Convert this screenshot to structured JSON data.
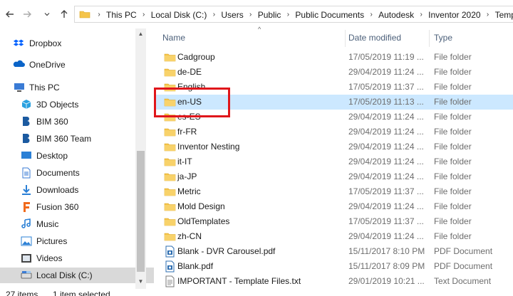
{
  "breadcrumb": [
    "This PC",
    "Local Disk (C:)",
    "Users",
    "Public",
    "Public Documents",
    "Autodesk",
    "Inventor 2020",
    "Templates"
  ],
  "columns": {
    "name": "Name",
    "date": "Date modified",
    "type": "Type"
  },
  "sidebar": {
    "items": [
      {
        "label": "Dropbox",
        "icon": "dropbox-icon",
        "color": "#0061fe"
      },
      {
        "label": "OneDrive",
        "icon": "onedrive-icon",
        "color": "#0a64c8"
      },
      {
        "label": "This PC",
        "icon": "pc-icon",
        "color": "#3a7bd5"
      },
      {
        "label": "3D Objects",
        "icon": "3d-objects-icon",
        "color": "#2aa1e0"
      },
      {
        "label": "BIM 360",
        "icon": "bim360-icon",
        "color": "#1b5aa0"
      },
      {
        "label": "BIM 360 Team",
        "icon": "bim360-team-icon",
        "color": "#1b5aa0"
      },
      {
        "label": "Desktop",
        "icon": "desktop-icon",
        "color": "#2b80d6"
      },
      {
        "label": "Documents",
        "icon": "documents-icon",
        "color": "#3a7bd5"
      },
      {
        "label": "Downloads",
        "icon": "downloads-icon",
        "color": "#2b80d6"
      },
      {
        "label": "Fusion 360",
        "icon": "fusion360-icon",
        "color": "#f06a1c"
      },
      {
        "label": "Music",
        "icon": "music-icon",
        "color": "#2b80d6"
      },
      {
        "label": "Pictures",
        "icon": "pictures-icon",
        "color": "#2b80d6"
      },
      {
        "label": "Videos",
        "icon": "videos-icon",
        "color": "#444444"
      },
      {
        "label": "Local Disk (C:)",
        "icon": "drive-icon",
        "color": "#666666"
      }
    ]
  },
  "files": [
    {
      "name": "Cadgroup",
      "date": "17/05/2019 11:19 ...",
      "type": "File folder",
      "kind": "folder"
    },
    {
      "name": "de-DE",
      "date": "29/04/2019 11:24 ...",
      "type": "File folder",
      "kind": "folder"
    },
    {
      "name": "English",
      "date": "17/05/2019 11:37 ...",
      "type": "File folder",
      "kind": "folder"
    },
    {
      "name": "en-US",
      "date": "17/05/2019 11:13 ...",
      "type": "File folder",
      "kind": "folder",
      "selected": true
    },
    {
      "name": "es-ES",
      "date": "29/04/2019 11:24 ...",
      "type": "File folder",
      "kind": "folder"
    },
    {
      "name": "fr-FR",
      "date": "29/04/2019 11:24 ...",
      "type": "File folder",
      "kind": "folder"
    },
    {
      "name": "Inventor Nesting",
      "date": "29/04/2019 11:24 ...",
      "type": "File folder",
      "kind": "folder"
    },
    {
      "name": "it-IT",
      "date": "29/04/2019 11:24 ...",
      "type": "File folder",
      "kind": "folder"
    },
    {
      "name": "ja-JP",
      "date": "29/04/2019 11:24 ...",
      "type": "File folder",
      "kind": "folder"
    },
    {
      "name": "Metric",
      "date": "17/05/2019 11:37 ...",
      "type": "File folder",
      "kind": "folder"
    },
    {
      "name": "Mold Design",
      "date": "29/04/2019 11:24 ...",
      "type": "File folder",
      "kind": "folder"
    },
    {
      "name": "OldTemplates",
      "date": "17/05/2019 11:37 ...",
      "type": "File folder",
      "kind": "folder"
    },
    {
      "name": "zh-CN",
      "date": "29/04/2019 11:24 ...",
      "type": "File folder",
      "kind": "folder"
    },
    {
      "name": "Blank - DVR Carousel.pdf",
      "date": "15/11/2017 8:10 PM",
      "type": "PDF Document",
      "kind": "pdf"
    },
    {
      "name": "Blank.pdf",
      "date": "15/11/2017 8:09 PM",
      "type": "PDF Document",
      "kind": "pdf"
    },
    {
      "name": "IMPORTANT - Template Files.txt",
      "date": "29/01/2019 10:21 ...",
      "type": "Text Document",
      "kind": "txt"
    }
  ],
  "status": {
    "item_count": "27 items",
    "selected": "1 item selected"
  },
  "colors": {
    "selection": "#cce8ff",
    "highlight_box": "#e0161b",
    "folder": "#f5c44a",
    "header_text": "#4c607a"
  }
}
